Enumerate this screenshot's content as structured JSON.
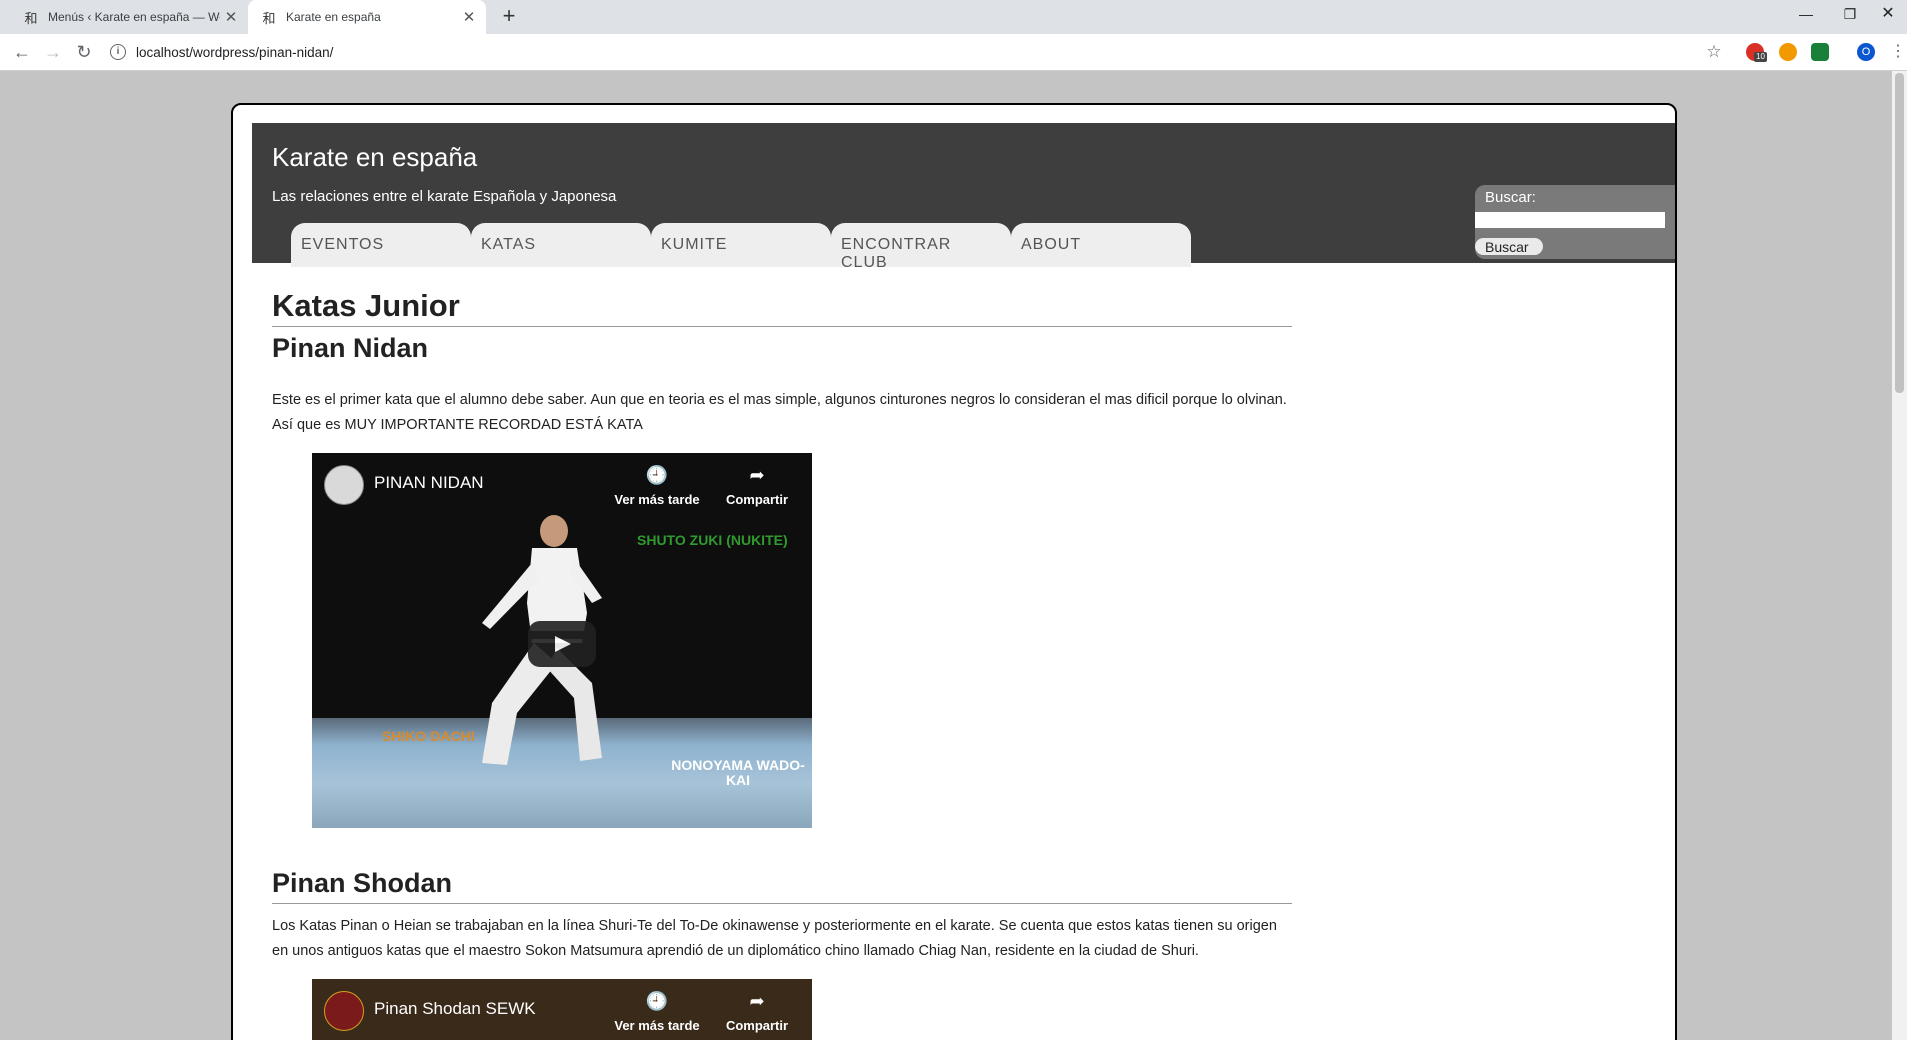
{
  "browser": {
    "tabs": [
      {
        "title": "Menús ‹ Karate en españa — Wo",
        "favicon": "kanji-favicon",
        "active": false
      },
      {
        "title": "Karate en españa",
        "favicon": "kanji-favicon",
        "active": true
      }
    ],
    "favicon_glyph": "和",
    "new_tab_icon": "+",
    "close_icon": "✕",
    "url": "localhost/wordpress/pinan-nidan/",
    "extension_badge": "10",
    "profile_initial": "O"
  },
  "site": {
    "title": "Karate en españa",
    "description": "Las relaciones entre el karate Española y Japonesa",
    "menu": [
      "EVENTOS",
      "KATAS",
      "KUMITE",
      "ENCONTRAR CLUB",
      "ABOUT"
    ],
    "search": {
      "label": "Buscar:",
      "button": "Buscar",
      "value": ""
    }
  },
  "content": {
    "page_title": "Katas Junior",
    "sections": [
      {
        "title": "Pinan Nidan",
        "text": "Este es el primer kata que el alumno debe saber. Aun que en teoria es el mas simple, algunos cinturones negros lo consideran el mas dificil porque lo olvinan. Así que es MUY IMPORTANTE RECORDAD ESTÁ KATA",
        "video": {
          "title": "PINAN NIDAN",
          "watch_later": "Ver más tarde",
          "share": "Compartir",
          "captions": [
            "SHUTO ZUKI (NUKITE)",
            "SHIKO DACHI",
            "NONOYAMA WADO-KAI"
          ]
        }
      },
      {
        "title": "Pinan Shodan",
        "text": "Los Katas Pinan o Heian se trabajaban en la línea Shuri-Te del To-De okinawense y posteriormente en el karate. Se cuenta que estos katas tienen su origen en unos antiguos katas que el maestro Sokon Matsumura aprendió de un diplomático chino llamado Chiag Nan, residente en la ciudad de Shuri.",
        "video": {
          "title": "Pinan Shodan SEWK",
          "watch_later": "Ver más tarde",
          "share": "Compartir"
        }
      }
    ]
  },
  "colors": {
    "header_bg": "#3e3e3e",
    "menu_bg": "#eeeeee",
    "page_bg": "#c4c4c4"
  }
}
